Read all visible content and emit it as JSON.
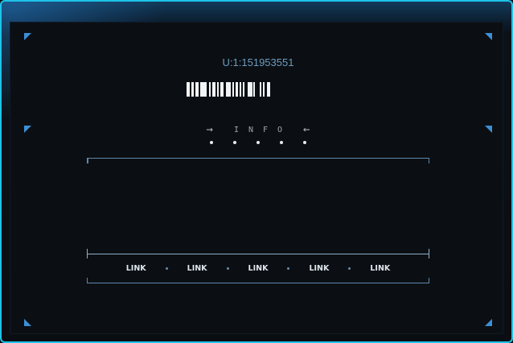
{
  "user": {
    "id_label": "U:1:151953551"
  },
  "barcode": {
    "bars": [
      2,
      1,
      2,
      1,
      2,
      1,
      4,
      2,
      1,
      1,
      2,
      1,
      1,
      1,
      2,
      2,
      3,
      1,
      1,
      1,
      2,
      1,
      1,
      1,
      1,
      2,
      3,
      1,
      1,
      3,
      1,
      1,
      1,
      2,
      2,
      1
    ]
  },
  "section": {
    "left_arrow": "→",
    "label": "INFO",
    "right_arrow": "←",
    "dot_count": 5
  },
  "footer_links": [
    "LINK",
    "LINK",
    "LINK",
    "LINK",
    "LINK"
  ],
  "colors": {
    "frame_border": "#1ec3e8",
    "corner_accent": "#3d8fd6",
    "id_text": "#6d9cc0",
    "link_text": "#dfe6ee"
  },
  "icons": {
    "corner": "corner-triangle-icon",
    "dot": "bullet-dot-icon"
  }
}
